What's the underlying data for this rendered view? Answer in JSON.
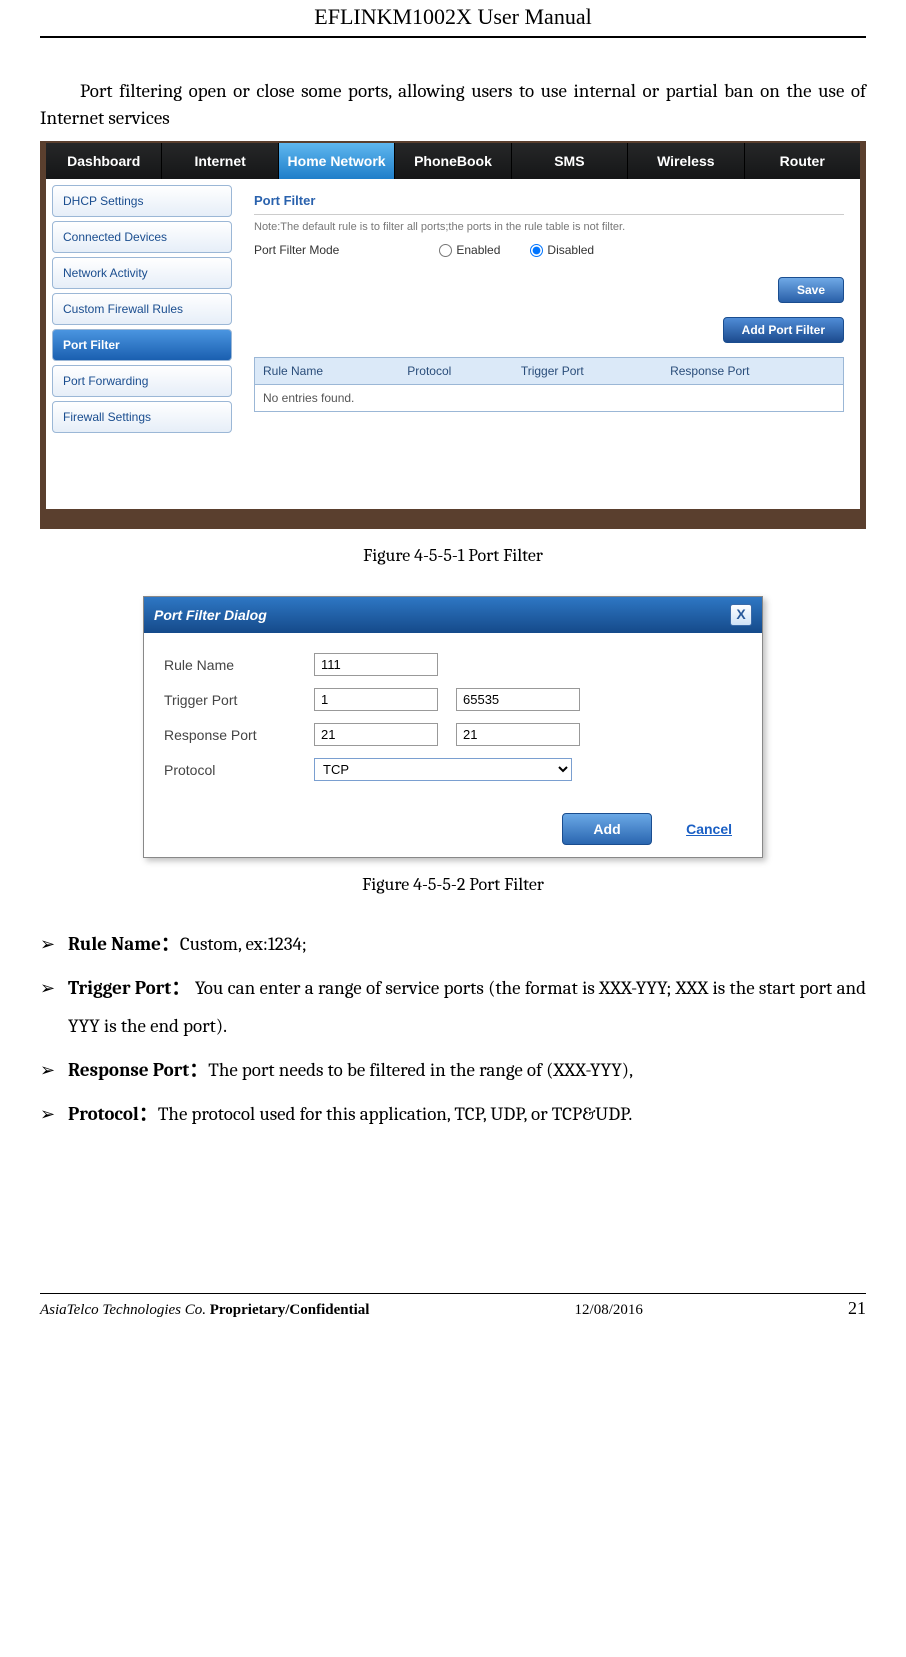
{
  "header": {
    "model": "EFLINKM1002X",
    "title_rest": " User Manual"
  },
  "intro": "Port filtering open or close some ports, allowing users to use internal or partial ban on the use of Internet services",
  "screenshot1": {
    "topnav": [
      "Dashboard",
      "Internet",
      "Home Network",
      "PhoneBook",
      "SMS",
      "Wireless",
      "Router"
    ],
    "topnav_active_index": 2,
    "sidebar": [
      "DHCP Settings",
      "Connected Devices",
      "Network Activity",
      "Custom Firewall Rules",
      "Port Filter",
      "Port Forwarding",
      "Firewall Settings"
    ],
    "sidebar_active_index": 4,
    "panel_title": "Port Filter",
    "note": "Note:The default rule is to filter all ports;the ports in the rule table is not filter.",
    "mode_label": "Port Filter Mode",
    "mode_options": {
      "enabled": "Enabled",
      "disabled": "Disabled"
    },
    "mode_selected": "disabled",
    "save_btn": "Save",
    "add_btn": "Add Port Filter",
    "table_headers": [
      "Rule Name",
      "Protocol",
      "Trigger Port",
      "Response Port"
    ],
    "table_empty": "No entries found."
  },
  "caption1": "Figure 4-5-5-1 Port Filter",
  "dialog": {
    "title": "Port Filter Dialog",
    "rows": {
      "rule_name": {
        "label": "Rule Name",
        "value": "111"
      },
      "trigger": {
        "label": "Trigger Port",
        "from": "1",
        "to": "65535"
      },
      "response": {
        "label": "Response Port",
        "from": "21",
        "to": "21"
      },
      "protocol": {
        "label": "Protocol",
        "value": "TCP"
      }
    },
    "add_btn": "Add",
    "cancel": "Cancel"
  },
  "caption2": "Figure 4-5-5-2 Port Filter",
  "defs": {
    "rule_name": {
      "bold": "Rule Name：",
      "rest": "Custom, ex:1234;"
    },
    "trigger": {
      "bold": "Trigger Port：",
      "rest": " You can enter a range of service ports (the format is XXX-YYY; XXX is the start port and YYY is the end port)."
    },
    "response": {
      "bold": "Response Port：",
      "rest": "The port needs to be filtered in the range of (XXX-YYY),"
    },
    "protocol": {
      "bold": "Protocol：",
      "rest": "The protocol used for this application, TCP, UDP, or TCP&UDP."
    }
  },
  "footer": {
    "company": "AsiaTelco Technologies Co. ",
    "conf": "Proprietary/Confidential",
    "date": "12/08/2016",
    "page": "21"
  }
}
